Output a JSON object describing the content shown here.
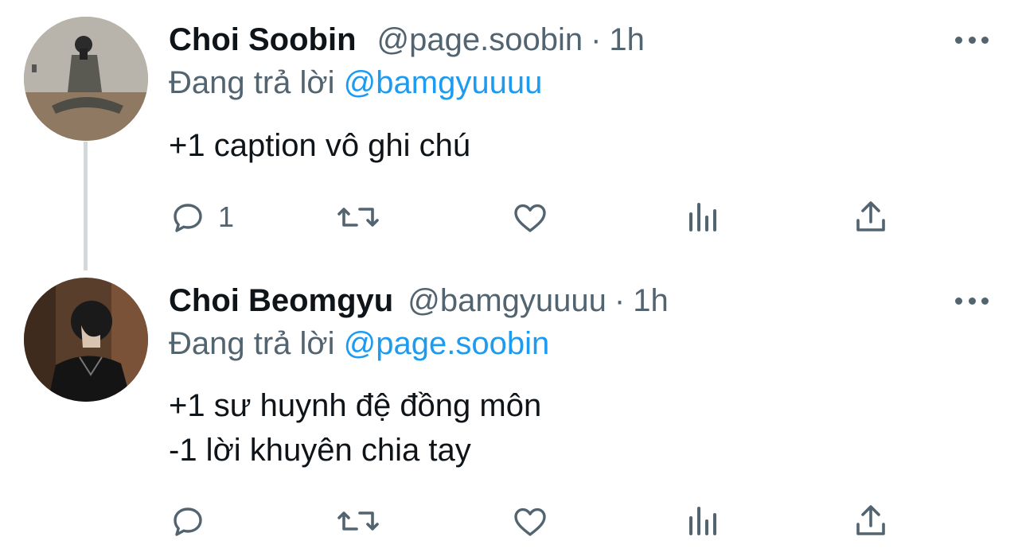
{
  "tweets": [
    {
      "name": "Choi Soobin",
      "handle": "@page.soobin",
      "separator": "·",
      "time": "1h",
      "replying_prefix": "Đang trả lời",
      "replying_to": "@bamgyuuuu",
      "lines": [
        "+1 caption vô ghi chú"
      ],
      "reply_count": "1"
    },
    {
      "name": "Choi Beomgyu",
      "handle": "@bamgyuuuu",
      "separator": "·",
      "time": "1h",
      "replying_prefix": "Đang trả lời",
      "replying_to": "@page.soobin",
      "lines": [
        "+1 sư huynh đệ đồng môn",
        "-1 lời khuyên chia tay"
      ],
      "reply_count": ""
    }
  ],
  "colors": {
    "text": "#0f1419",
    "secondary": "#536471",
    "accent": "#1d9bf0",
    "thread_line": "#cfd9de"
  },
  "icons": [
    "reply-icon",
    "retweet-icon",
    "like-icon",
    "analytics-icon",
    "share-icon",
    "more-icon"
  ]
}
